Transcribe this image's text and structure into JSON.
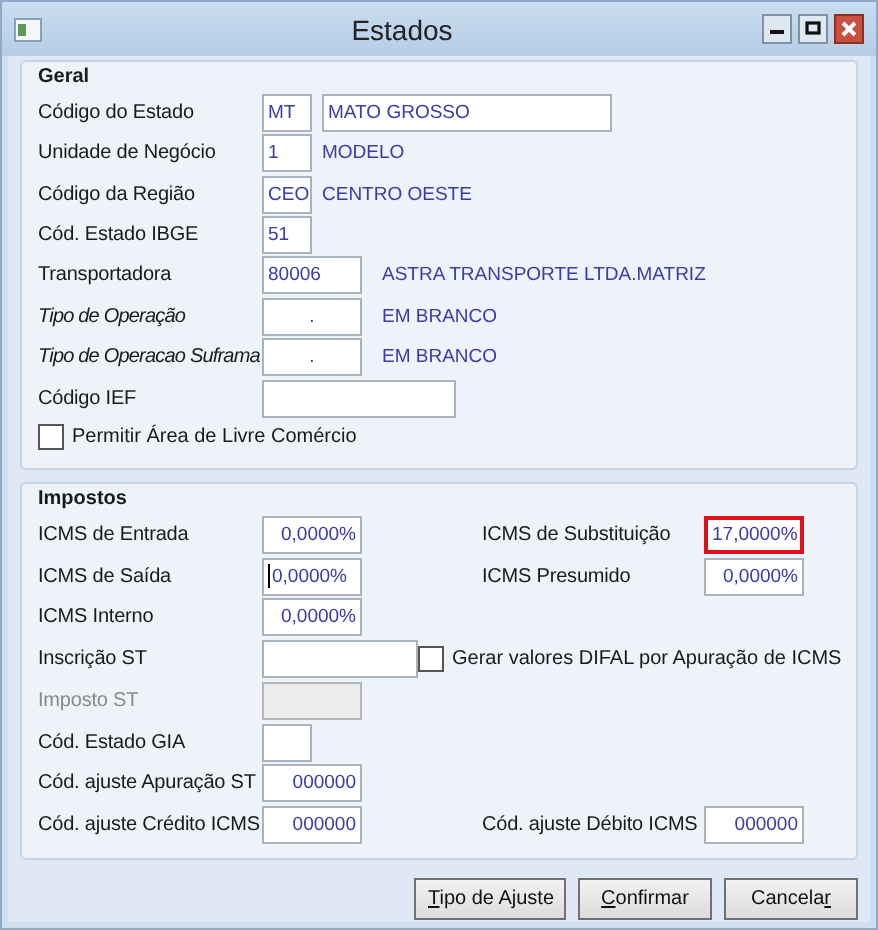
{
  "window": {
    "title": "Estados"
  },
  "geral": {
    "title": "Geral",
    "fields": [
      {
        "label": "Código do Estado",
        "italic": false,
        "kind": "state",
        "code": "MT",
        "description": "MATO GROSSO"
      },
      {
        "label": "Unidade de Negócio",
        "italic": false,
        "kind": "short",
        "code": "1",
        "description": "MODELO"
      },
      {
        "label": "Código da Região",
        "italic": false,
        "kind": "short",
        "code": "CEO",
        "description": "CENTRO OESTE"
      },
      {
        "label": "Cód. Estado IBGE",
        "italic": false,
        "kind": "short",
        "code": "51"
      },
      {
        "label": "Transportadora",
        "italic": false,
        "kind": "long",
        "code": "80006",
        "description": "ASTRA TRANSPORTE LTDA.MATRIZ"
      },
      {
        "label": "Tipo de Operação",
        "italic": true,
        "kind": "long",
        "code": ".",
        "description": "EM BRANCO"
      },
      {
        "label": "Tipo de Operacao Suframa",
        "italic": true,
        "kind": "long",
        "code": ".",
        "description": "EM BRANCO"
      },
      {
        "label": "Código IEF",
        "italic": false,
        "kind": "entry"
      }
    ],
    "checkbox": {
      "label": "Permitir Área de Livre Comércio",
      "checked": false
    }
  },
  "impostos": {
    "title": "Impostos",
    "rows": [
      {
        "left": {
          "label": "ICMS de Entrada",
          "kind": "percent",
          "value": "0,0000%",
          "disabled": false,
          "focused": false
        },
        "right": {
          "kind": "field",
          "label": "ICMS de Substituição",
          "value": "17,0000%",
          "highlighted": true
        }
      },
      {
        "left": {
          "label": "ICMS de Saída",
          "kind": "percent",
          "value": "0,0000%",
          "disabled": false,
          "focused": true
        },
        "right": {
          "kind": "field",
          "label": "ICMS Presumido",
          "value": "0,0000%",
          "highlighted": false
        }
      },
      {
        "left": {
          "label": "ICMS Interno",
          "kind": "percent",
          "value": "0,0000%",
          "disabled": false,
          "focused": false
        }
      },
      {
        "left": {
          "label": "Inscrição ST",
          "kind": "text",
          "disabled": false,
          "focused": false
        },
        "right": {
          "kind": "checkbox",
          "label": "Gerar valores DIFAL por Apuração de ICMS",
          "checked": false
        }
      },
      {
        "left": {
          "label": "Imposto ST",
          "kind": "percent",
          "disabled": true,
          "focused": false
        }
      },
      {
        "left": {
          "label": "Cód. Estado GIA",
          "kind": "short",
          "disabled": false,
          "focused": false
        }
      },
      {
        "left": {
          "label": "Cód. ajuste Apuração ST",
          "kind": "percent",
          "value": "000000",
          "disabled": false,
          "focused": false
        }
      },
      {
        "left": {
          "label": "Cód. ajuste Crédito ICMS",
          "kind": "percent",
          "value": "000000",
          "disabled": false,
          "focused": false
        },
        "right": {
          "kind": "field",
          "label": "Cód. ajuste Débito ICMS",
          "value": "000000",
          "highlighted": false
        }
      }
    ]
  },
  "buttons": [
    {
      "mnemonic": "T",
      "after": "ipo de Ajuste"
    },
    {
      "mnemonic": "C",
      "after": "onfirmar"
    },
    {
      "before": "Cancela",
      "mnemonic": "r"
    }
  ]
}
